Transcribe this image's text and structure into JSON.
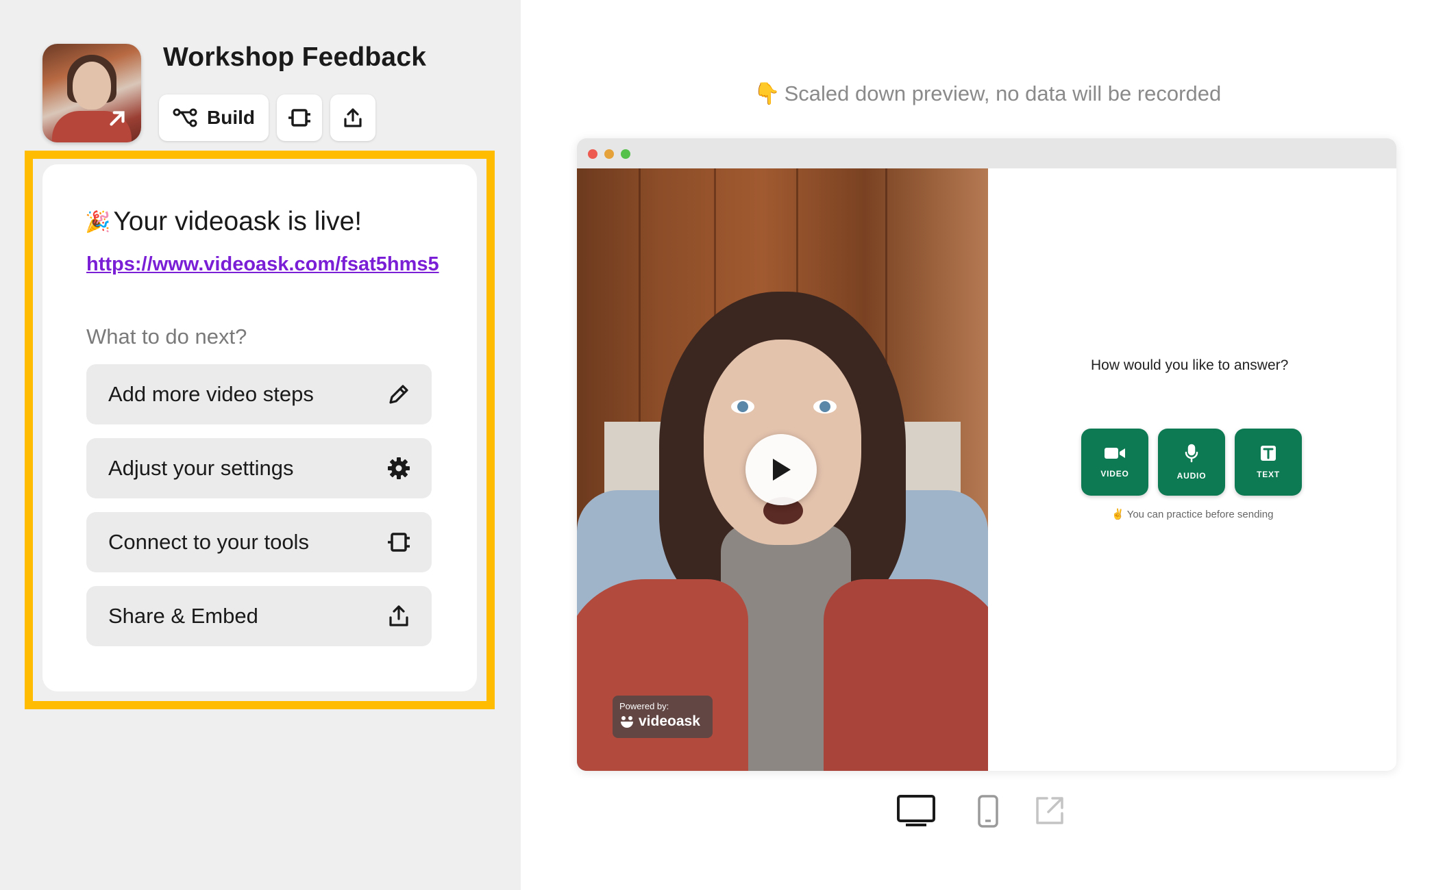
{
  "header": {
    "title": "Workshop Feedback",
    "build_label": "Build"
  },
  "card": {
    "live_emoji": "🎉",
    "live_title": "Your videoask is live!",
    "link": "https://www.videoask.com/fsat5hms5",
    "next_label": "What to do next?",
    "actions": [
      {
        "label": "Add more video steps",
        "icon": "pencil-icon"
      },
      {
        "label": "Adjust your settings",
        "icon": "gear-icon"
      },
      {
        "label": "Connect to your tools",
        "icon": "plug-icon"
      },
      {
        "label": "Share & Embed",
        "icon": "share-icon"
      }
    ]
  },
  "preview": {
    "note_emoji": "👇",
    "note": "Scaled down preview, no data will be recorded",
    "answer_question": "How would you like to answer?",
    "answer_options": [
      {
        "label": "VIDEO",
        "icon": "video-camera-icon"
      },
      {
        "label": "AUDIO",
        "icon": "microphone-icon"
      },
      {
        "label": "TEXT",
        "icon": "text-icon"
      }
    ],
    "practice_emoji": "✌️",
    "practice_note": "You can practice before sending",
    "powered_by": "Powered by:",
    "brand": "videoask"
  },
  "devices": [
    {
      "name": "desktop-icon",
      "active": true
    },
    {
      "name": "mobile-icon",
      "active": false
    },
    {
      "name": "open-external-icon",
      "active": false
    }
  ],
  "colors": {
    "highlight": "#ffbc00",
    "link": "#7b1fd6",
    "answer_button": "#0e7a53"
  }
}
